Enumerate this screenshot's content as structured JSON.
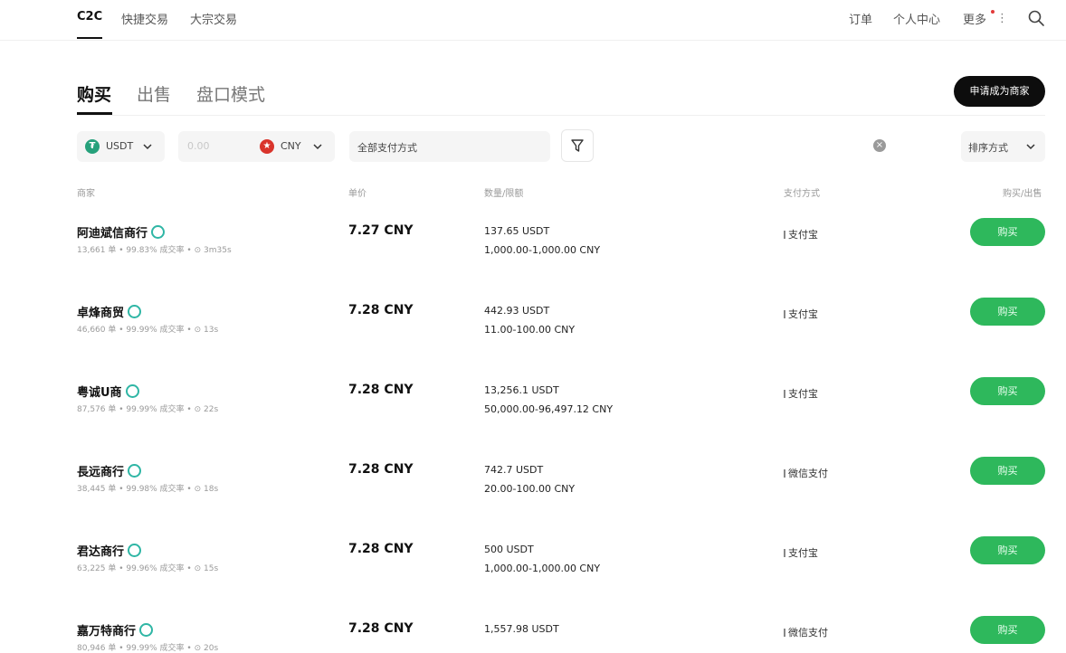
{
  "topnav": {
    "items": [
      "C2C",
      "快捷交易",
      "大宗交易"
    ],
    "right": [
      "订单",
      "个人中心",
      "更多"
    ],
    "accent_color": "#e23b3b"
  },
  "tabs": [
    "购买",
    "出售",
    "盘口模式"
  ],
  "merchant_button": "申请成为商家",
  "filters": {
    "coin": "USDT",
    "amount_placeholder": "0.00",
    "currency": "CNY",
    "payment": "全部支付方式",
    "sort": "排序方式"
  },
  "columns": [
    "商家",
    "单价",
    "数量/限额",
    "支付方式",
    "购买/出售"
  ],
  "buy_color": "#2eb85c",
  "rows": [
    {
      "name": "阿迪斌信商行",
      "stats": "13,661 单 • 99.83% 成交率 • ⊙ 3m35s",
      "price": "7.27 CNY",
      "qty": "137.65 USDT",
      "limit": "1,000.00-1,000.00 CNY",
      "pay": "支付宝",
      "action": "购买"
    },
    {
      "name": "卓烽商贸",
      "stats": "46,660 单 • 99.99% 成交率 • ⊙ 13s",
      "price": "7.28 CNY",
      "qty": "442.93 USDT",
      "limit": "11.00-100.00 CNY",
      "pay": "支付宝",
      "action": "购买"
    },
    {
      "name": "粤诚U商",
      "stats": "87,576 单 • 99.99% 成交率 • ⊙ 22s",
      "price": "7.28 CNY",
      "qty": "13,256.1 USDT",
      "limit": "50,000.00-96,497.12 CNY",
      "pay": "支付宝",
      "action": "购买"
    },
    {
      "name": "長远商行",
      "stats": "38,445 单 • 99.98% 成交率 • ⊙ 18s",
      "price": "7.28 CNY",
      "qty": "742.7 USDT",
      "limit": "20.00-100.00 CNY",
      "pay": "微信支付",
      "action": "购买"
    },
    {
      "name": "君达商行",
      "stats": "63,225 单 • 99.96% 成交率 • ⊙ 15s",
      "price": "7.28 CNY",
      "qty": "500 USDT",
      "limit": "1,000.00-1,000.00 CNY",
      "pay": "支付宝",
      "action": "购买"
    },
    {
      "name": "嘉万特商行",
      "stats": "80,946 单 • 99.99% 成交率 • ⊙ 20s",
      "price": "7.28 CNY",
      "qty": "1,557.98 USDT",
      "limit": "",
      "pay": "微信支付",
      "action": "购买"
    }
  ]
}
